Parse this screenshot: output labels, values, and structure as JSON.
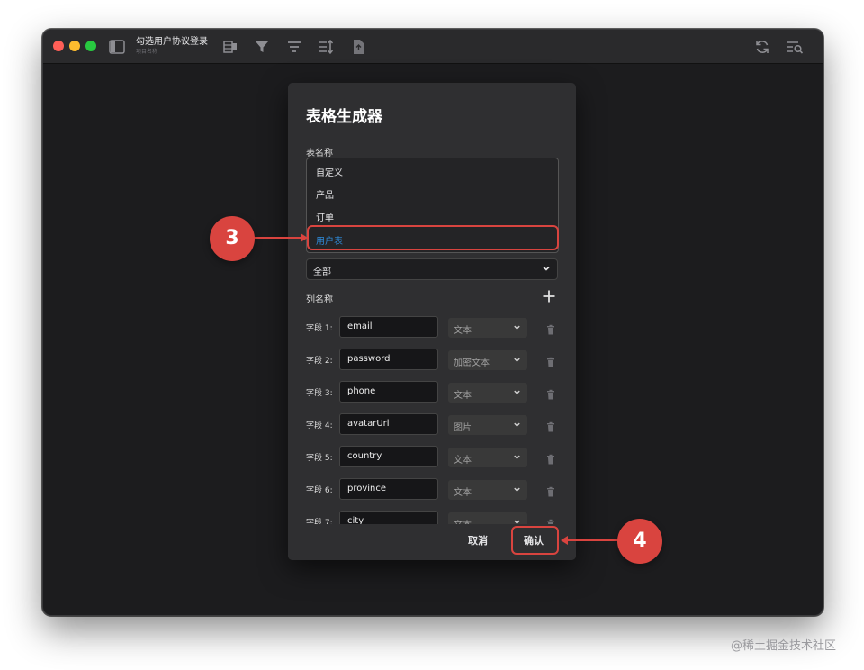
{
  "window": {
    "project_title": "勾选用户协议登录",
    "project_subtitle": "项目名称"
  },
  "dialog": {
    "title": "表格生成器",
    "table_name_label": "表名称",
    "dropdown_options": [
      "自定义",
      "产品",
      "订单",
      "用户表"
    ],
    "selected_option": "用户表",
    "filter_value": "全部",
    "columns_label": "列名称",
    "cancel_label": "取消",
    "confirm_label": "确认"
  },
  "fields": [
    {
      "label": "字段 1:",
      "value": "email",
      "type": "文本"
    },
    {
      "label": "字段 2:",
      "value": "password",
      "type": "加密文本"
    },
    {
      "label": "字段 3:",
      "value": "phone",
      "type": "文本"
    },
    {
      "label": "字段 4:",
      "value": "avatarUrl",
      "type": "图片"
    },
    {
      "label": "字段 5:",
      "value": "country",
      "type": "文本"
    },
    {
      "label": "字段 6:",
      "value": "province",
      "type": "文本"
    },
    {
      "label": "字段 7:",
      "value": "city",
      "type": "文本"
    }
  ],
  "annotations": {
    "step_3": "3",
    "step_4": "4",
    "color": "#d9443f"
  },
  "watermark": "@稀土掘金技术社区"
}
